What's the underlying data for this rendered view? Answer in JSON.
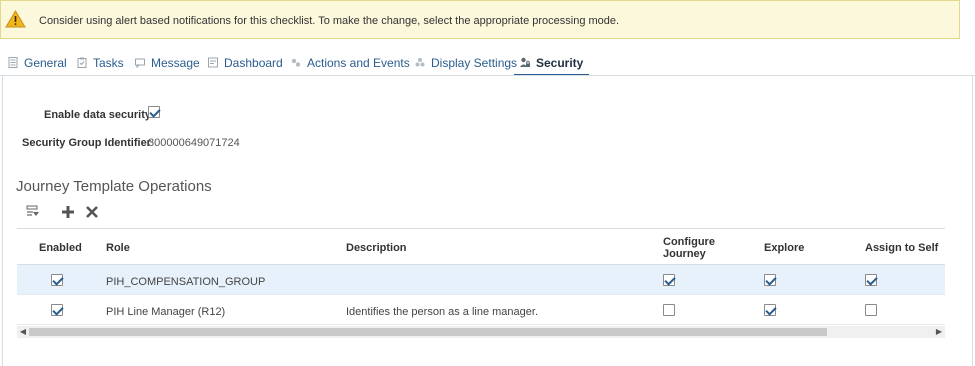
{
  "alert": {
    "icon": "warning-icon",
    "message": "Consider using alert based notifications for this checklist. To make the change, select the appropriate processing mode."
  },
  "tabs": [
    {
      "label": "General",
      "icon": "document-icon",
      "active": false
    },
    {
      "label": "Tasks",
      "icon": "clipboard-icon",
      "active": false
    },
    {
      "label": "Message",
      "icon": "message-icon",
      "active": false
    },
    {
      "label": "Dashboard",
      "icon": "dashboard-icon",
      "active": false
    },
    {
      "label": "Actions and Events",
      "icon": "gears-icon",
      "active": false
    },
    {
      "label": "Display Settings",
      "icon": "palette-icon",
      "active": false
    },
    {
      "label": "Security",
      "icon": "user-lock-icon",
      "active": true
    }
  ],
  "security": {
    "enable_label": "Enable data security",
    "enable_checked": true,
    "group_id_label": "Security Group Identifier",
    "group_id_value": "300000649071724"
  },
  "operations": {
    "title": "Journey Template Operations",
    "toolbar": {
      "filter_icon": "filter-icon",
      "add_icon": "plus-icon",
      "delete_icon": "x-icon"
    },
    "columns": {
      "enabled": "Enabled",
      "role": "Role",
      "description": "Description",
      "configure_line1": "Configure",
      "configure_line2": "Journey",
      "explore": "Explore",
      "assign": "Assign to Self"
    },
    "rows": [
      {
        "enabled": true,
        "role": "PIH_COMPENSATION_GROUP",
        "description": "",
        "configure": true,
        "explore": true,
        "assign": true,
        "selected": true
      },
      {
        "enabled": true,
        "role": "PIH Line Manager (R12)",
        "description": "Identifies the person as a line manager.",
        "configure": false,
        "explore": true,
        "assign": false,
        "selected": false
      }
    ]
  },
  "colors": {
    "accent": "#2a5d8f",
    "alert_bg": "#fcf8dc",
    "selected_row": "#e6f1fb"
  }
}
